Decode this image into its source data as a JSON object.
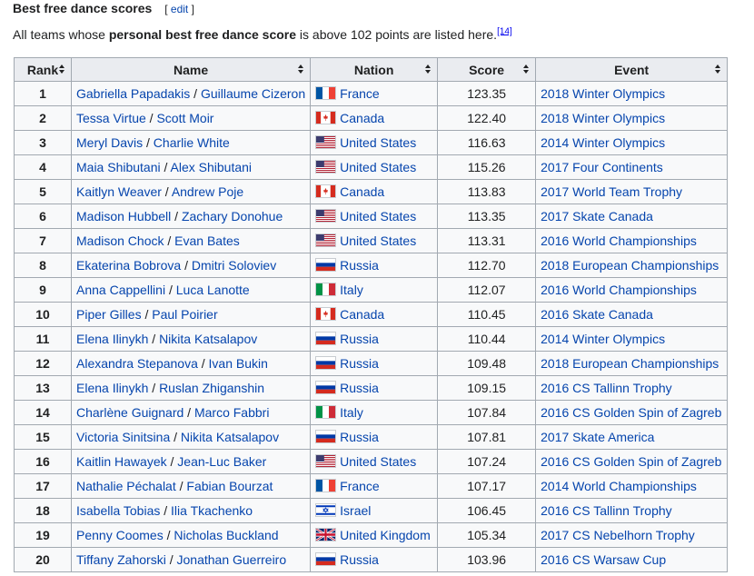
{
  "section": {
    "title": "Best free dance scores",
    "edit_open": "[",
    "edit_label": "edit",
    "edit_close": "]"
  },
  "intro": {
    "before": "All teams whose ",
    "bold": "personal best free dance score",
    "after": " is above 102 points are listed here.",
    "ref": "[14]"
  },
  "table": {
    "headers": [
      "Rank",
      "Name",
      "Nation",
      "Score",
      "Event"
    ],
    "rows": [
      {
        "rank": "1",
        "skater1": "Gabriella Papadakis",
        "skater2": "Guillaume Cizeron",
        "nation": "France",
        "flag": "france",
        "score": "123.35",
        "event": "2018 Winter Olympics"
      },
      {
        "rank": "2",
        "skater1": "Tessa Virtue",
        "skater2": "Scott Moir",
        "nation": "Canada",
        "flag": "canada",
        "score": "122.40",
        "event": "2018 Winter Olympics"
      },
      {
        "rank": "3",
        "skater1": "Meryl Davis",
        "skater2": "Charlie White",
        "nation": "United States",
        "flag": "usa",
        "score": "116.63",
        "event": "2014 Winter Olympics"
      },
      {
        "rank": "4",
        "skater1": "Maia Shibutani",
        "skater2": "Alex Shibutani",
        "nation": "United States",
        "flag": "usa",
        "score": "115.26",
        "event": "2017 Four Continents"
      },
      {
        "rank": "5",
        "skater1": "Kaitlyn Weaver",
        "skater2": "Andrew Poje",
        "nation": "Canada",
        "flag": "canada",
        "score": "113.83",
        "event": "2017 World Team Trophy"
      },
      {
        "rank": "6",
        "skater1": "Madison Hubbell",
        "skater2": "Zachary Donohue",
        "nation": "United States",
        "flag": "usa",
        "score": "113.35",
        "event": "2017 Skate Canada"
      },
      {
        "rank": "7",
        "skater1": "Madison Chock",
        "skater2": "Evan Bates",
        "nation": "United States",
        "flag": "usa",
        "score": "113.31",
        "event": "2016 World Championships"
      },
      {
        "rank": "8",
        "skater1": "Ekaterina Bobrova",
        "skater2": "Dmitri Soloviev",
        "nation": "Russia",
        "flag": "russia",
        "score": "112.70",
        "event": "2018 European Championships"
      },
      {
        "rank": "9",
        "skater1": "Anna Cappellini",
        "skater2": "Luca Lanotte",
        "nation": "Italy",
        "flag": "italy",
        "score": "112.07",
        "event": "2016 World Championships"
      },
      {
        "rank": "10",
        "skater1": "Piper Gilles",
        "skater2": "Paul Poirier",
        "nation": "Canada",
        "flag": "canada",
        "score": "110.45",
        "event": "2016 Skate Canada"
      },
      {
        "rank": "11",
        "skater1": "Elena Ilinykh",
        "skater2": "Nikita Katsalapov",
        "nation": "Russia",
        "flag": "russia",
        "score": "110.44",
        "event": "2014 Winter Olympics"
      },
      {
        "rank": "12",
        "skater1": "Alexandra Stepanova",
        "skater2": "Ivan Bukin",
        "nation": "Russia",
        "flag": "russia",
        "score": "109.48",
        "event": "2018 European Championships"
      },
      {
        "rank": "13",
        "skater1": "Elena Ilinykh",
        "skater2": "Ruslan Zhiganshin",
        "nation": "Russia",
        "flag": "russia",
        "score": "109.15",
        "event": "2016 CS Tallinn Trophy"
      },
      {
        "rank": "14",
        "skater1": "Charlène Guignard",
        "skater2": "Marco Fabbri",
        "nation": "Italy",
        "flag": "italy",
        "score": "107.84",
        "event": "2016 CS Golden Spin of Zagreb"
      },
      {
        "rank": "15",
        "skater1": "Victoria Sinitsina",
        "skater2": "Nikita Katsalapov",
        "nation": "Russia",
        "flag": "russia",
        "score": "107.81",
        "event": "2017 Skate America"
      },
      {
        "rank": "16",
        "skater1": "Kaitlin Hawayek",
        "skater2": "Jean-Luc Baker",
        "nation": "United States",
        "flag": "usa",
        "score": "107.24",
        "event": "2016 CS Golden Spin of Zagreb"
      },
      {
        "rank": "17",
        "skater1": "Nathalie Péchalat",
        "skater2": "Fabian Bourzat",
        "nation": "France",
        "flag": "france",
        "score": "107.17",
        "event": "2014 World Championships"
      },
      {
        "rank": "18",
        "skater1": "Isabella Tobias",
        "skater2": "Ilia Tkachenko",
        "nation": "Israel",
        "flag": "israel",
        "score": "106.45",
        "event": "2016 CS Tallinn Trophy"
      },
      {
        "rank": "19",
        "skater1": "Penny Coomes",
        "skater2": "Nicholas Buckland",
        "nation": "United Kingdom",
        "flag": "uk",
        "score": "105.34",
        "event": "2017 CS Nebelhorn Trophy"
      },
      {
        "rank": "20",
        "skater1": "Tiffany Zahorski",
        "skater2": "Jonathan Guerreiro",
        "nation": "Russia",
        "flag": "russia",
        "score": "103.96",
        "event": "2016 CS Warsaw Cup"
      }
    ],
    "separator": " / "
  },
  "colors": {
    "link": "#0645ad",
    "header_bg": "#eaecf0",
    "cell_bg": "#f8f9fa",
    "border": "#a2a9b1"
  }
}
